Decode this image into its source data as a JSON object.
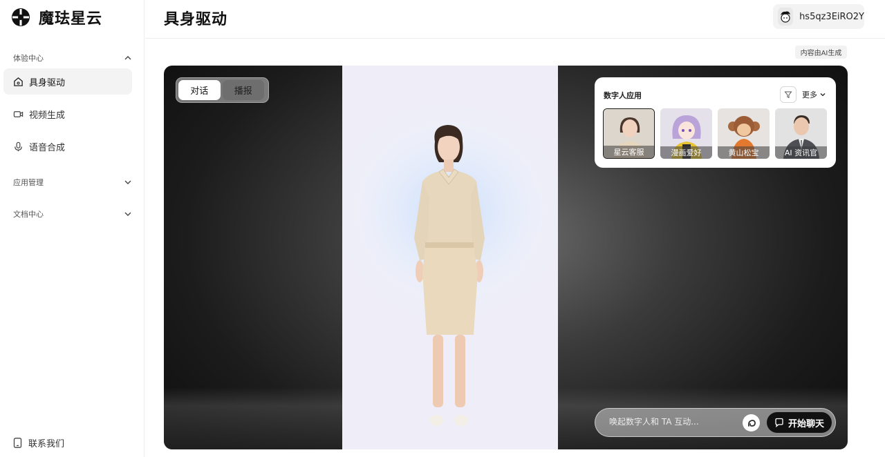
{
  "brand": {
    "name": "魔珐星云",
    "logo_icon": "brand-logo-icon"
  },
  "sidebar": {
    "sections": [
      {
        "label": "体验中心",
        "expanded": true
      },
      {
        "label": "应用管理",
        "expanded": false
      },
      {
        "label": "文档中心",
        "expanded": false
      }
    ],
    "items": [
      {
        "label": "具身驱动",
        "icon": "home-icon",
        "active": true
      },
      {
        "label": "视频生成",
        "icon": "video-icon",
        "active": false
      },
      {
        "label": "语音合成",
        "icon": "microphone-icon",
        "active": false
      }
    ],
    "contact": {
      "label": "联系我们",
      "icon": "phone-icon"
    }
  },
  "header": {
    "title": "具身驱动",
    "user": {
      "name": "hs5qz3EiRO2Y"
    }
  },
  "ai_badge": "内容由AI生成",
  "stage": {
    "modes": [
      {
        "label": "对话",
        "selected": true
      },
      {
        "label": "播报",
        "selected": false
      }
    ],
    "apps_panel": {
      "title": "数字人应用",
      "more_label": "更多",
      "cards": [
        {
          "label": "星云客服",
          "selected": true
        },
        {
          "label": "漫画爱好",
          "selected": false
        },
        {
          "label": "黄山松宝",
          "selected": false
        },
        {
          "label": "AI 资讯官",
          "selected": false
        }
      ]
    },
    "chat": {
      "placeholder": "唤起数字人和 TA 互动...",
      "start_label": "开始聊天"
    }
  },
  "colors": {
    "accent": "#111111",
    "sidebar_active_bg": "#f3f3f4"
  }
}
